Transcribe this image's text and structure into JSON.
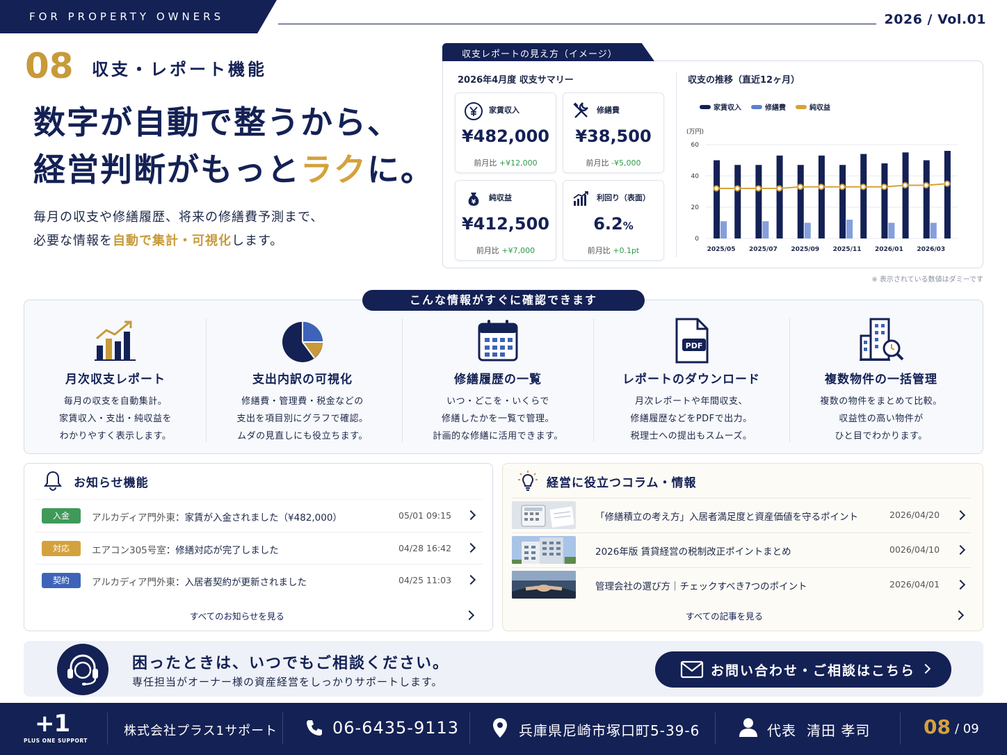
{
  "header": {
    "band": "FOR PROPERTY OWNERS",
    "issue": "2026 / Vol.01"
  },
  "section": {
    "number": "08",
    "title": "収支・レポート機能"
  },
  "hero": {
    "line1": "数字が自動で整うから、",
    "line2_pre": "経営判断がもっと",
    "line2_accent": "ラク",
    "line2_post": "に。"
  },
  "lead": {
    "line1": "毎月の収支や修繕履歴、将来の修繕費予測まで、",
    "line2_pre": "必要な情報を",
    "line2_accent": "自動で集計・可視化",
    "line2_post": "します。"
  },
  "report": {
    "tab": "収支レポートの見え方（イメージ）",
    "summary_title": "2026年4月度 収支サマリー",
    "kpis": [
      {
        "icon": "yen-icon",
        "label": "家賃収入",
        "value": "¥482,000",
        "cmp_label": "前月比",
        "cmp_value": "+¥12,000"
      },
      {
        "icon": "tools-icon",
        "label": "修繕費",
        "value": "¥38,500",
        "cmp_label": "前月比",
        "cmp_value": "-¥5,000"
      },
      {
        "icon": "money-bag-icon",
        "label": "純収益",
        "value": "¥412,500",
        "cmp_label": "前月比",
        "cmp_value": "+¥7,000"
      },
      {
        "icon": "bar-growth-icon",
        "label": "利回り（表面）",
        "value": "6.2",
        "unit": "%",
        "cmp_label": "前月比",
        "cmp_value": "+0.1pt"
      }
    ],
    "chart_title": "収支の推移（直近12ヶ月）",
    "note": "※ 表示されている数値はダミーです"
  },
  "chart_data": {
    "type": "bar",
    "title": "収支の推移（直近12ヶ月）",
    "ylabel": "(万円)",
    "ylim": [
      0,
      60
    ],
    "yticks": [
      0,
      20,
      40,
      60
    ],
    "categories": [
      "2025/05",
      "2025/06",
      "2025/07",
      "2025/08",
      "2025/09",
      "2025/10",
      "2025/11",
      "2025/12",
      "2026/01",
      "2026/02",
      "2026/03",
      "2026/04"
    ],
    "tick_labels": [
      "2025/05",
      "2025/07",
      "2025/09",
      "2025/11",
      "2026/01",
      "2026/03"
    ],
    "legend_position": "top-left",
    "grid": true,
    "series": [
      {
        "name": "家賃収入",
        "type": "bar",
        "color": "#142155",
        "values": [
          50,
          47,
          47,
          53,
          47,
          53,
          47,
          54,
          48,
          55,
          50,
          56
        ]
      },
      {
        "name": "修繕費",
        "type": "bar",
        "color": "#5b7fd0",
        "values": [
          11,
          0,
          11,
          0,
          10,
          0,
          12,
          0,
          10,
          0,
          10,
          0
        ]
      },
      {
        "name": "純収益",
        "type": "line",
        "color": "#d4a23c",
        "values": [
          32,
          32,
          32,
          32,
          33,
          33,
          33,
          33,
          33,
          34,
          34,
          35
        ]
      }
    ]
  },
  "features": {
    "title": "こんな情報がすぐに確認できます",
    "items": [
      {
        "icon": "bar-chart-growth-icon",
        "title": "月次収支レポート",
        "lines": [
          "毎月の収支を自動集計。",
          "家賃収入・支出・純収益を",
          "わかりやすく表示します。"
        ]
      },
      {
        "icon": "pie-chart-icon",
        "title": "支出内訳の可視化",
        "lines": [
          "修繕費・管理費・税金などの",
          "支出を項目別にグラフで確認。",
          "ムダの見直しにも役立ちます。"
        ]
      },
      {
        "icon": "calendar-icon",
        "title": "修繕履歴の一覧",
        "lines": [
          "いつ・どこを・いくらで",
          "修繕したかを一覧で管理。",
          "計画的な修繕に活用できます。"
        ]
      },
      {
        "icon": "pdf-icon",
        "title": "レポートのダウンロード",
        "lines": [
          "月次レポートや年間収支、",
          "修繕履歴などをPDFで出力。",
          "税理士への提出もスムーズ。"
        ]
      },
      {
        "icon": "building-search-icon",
        "title": "複数物件の一括管理",
        "lines": [
          "複数の物件をまとめて比較。",
          "収益性の高い物件が",
          "ひと目でわかります。"
        ]
      }
    ]
  },
  "news": {
    "title": "お知らせ機能",
    "items": [
      {
        "tag": "入金",
        "tag_color": "#3f9a5a",
        "subject": "アルカディア門外東",
        "body": "家賃が入金されました（¥482,000）",
        "time": "05/01 09:15"
      },
      {
        "tag": "対応",
        "tag_color": "#d4a23c",
        "subject": "エアコン305号室",
        "body": "修繕対応が完了しました",
        "time": "04/28 16:42"
      },
      {
        "tag": "契約",
        "tag_color": "#3d64b8",
        "subject": "アルカディア門外東",
        "body": "入居者契約が更新されました",
        "time": "04/25 11:03"
      }
    ],
    "more": "すべてのお知らせを見る"
  },
  "columns": {
    "title": "経営に役立つコラム・情報",
    "items": [
      {
        "thumb": "calculator-photo",
        "title": "「修繕積立の考え方」入居者満足度と資産価値を守るポイント",
        "date": "2026/04/20"
      },
      {
        "thumb": "building-photo",
        "title": "2026年版 賃貸経営の税制改正ポイントまとめ",
        "date": "0026/04/10"
      },
      {
        "thumb": "handshake-photo",
        "title": "管理会社の選び方｜チェックすべき7つのポイント",
        "date": "2026/04/01"
      }
    ],
    "more": "すべての記事を見る"
  },
  "consult": {
    "title": "困ったときは、いつでもご相談ください。",
    "sub": "専任担当がオーナー様の資産経営をしっかりサポートします。",
    "button": "お問い合わせ・ご相談はこちら"
  },
  "footer": {
    "logo": "+1",
    "logo_sub": "PLUS ONE SUPPORT",
    "company": "株式会社プラス1サポート",
    "tel": "06-6435-9113",
    "address": "兵庫県尼崎市塚口町5-39-6",
    "rep_label": "代表",
    "rep_name": "清田 孝司",
    "page": "08",
    "page_total": "/ 09"
  }
}
